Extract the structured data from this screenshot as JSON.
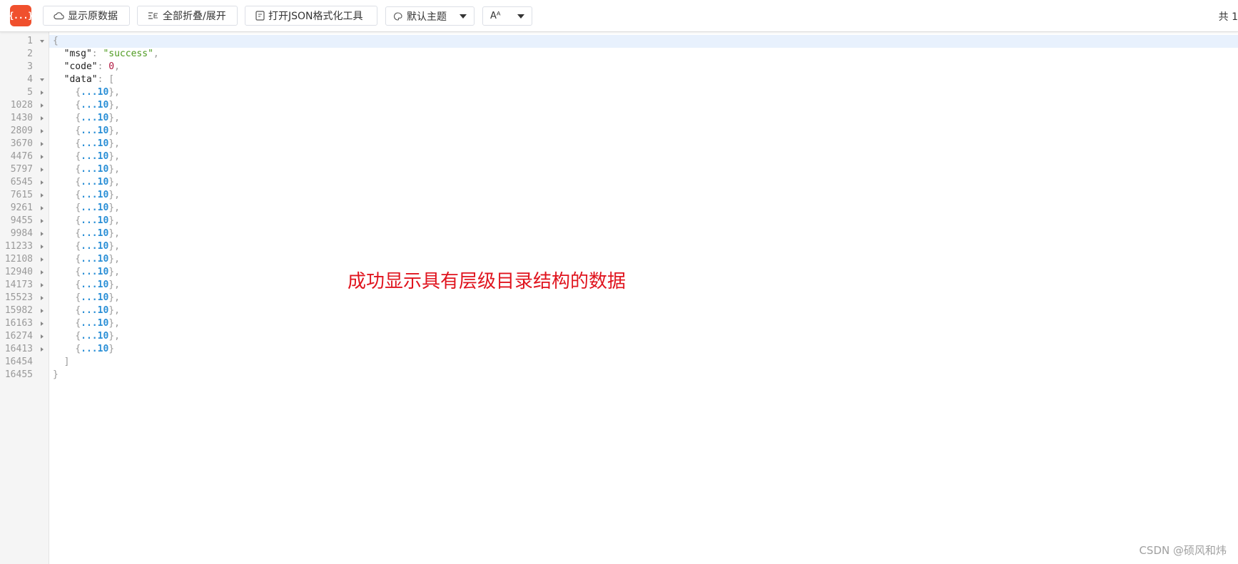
{
  "toolbar": {
    "logo_text": "{...}",
    "raw_button": "显示原数据",
    "collapse_button": "全部折叠/展开",
    "format_tool_button": "打开JSON格式化工具",
    "theme_select": "默认主题",
    "font_select": "Aᴬ",
    "total_label": "共 1"
  },
  "editor": {
    "root_open": "{",
    "root_close": "}",
    "msg_key": "\"msg\"",
    "msg_value": "\"success\"",
    "code_key": "\"code\"",
    "code_value": "0",
    "data_key": "\"data\"",
    "data_open": "[",
    "data_close": "]",
    "line_numbers": {
      "root": "1",
      "msg": "2",
      "code": "3",
      "data": "4",
      "data_close": "16454",
      "root_close": "16455"
    },
    "items": [
      {
        "line": "5",
        "summary": "...10",
        "comma": ","
      },
      {
        "line": "1028",
        "summary": "...10",
        "comma": ","
      },
      {
        "line": "1430",
        "summary": "...10",
        "comma": ","
      },
      {
        "line": "2809",
        "summary": "...10",
        "comma": ","
      },
      {
        "line": "3670",
        "summary": "...10",
        "comma": ","
      },
      {
        "line": "4476",
        "summary": "...10",
        "comma": ","
      },
      {
        "line": "5797",
        "summary": "...10",
        "comma": ","
      },
      {
        "line": "6545",
        "summary": "...10",
        "comma": ","
      },
      {
        "line": "7615",
        "summary": "...10",
        "comma": ","
      },
      {
        "line": "9261",
        "summary": "...10",
        "comma": ","
      },
      {
        "line": "9455",
        "summary": "...10",
        "comma": ","
      },
      {
        "line": "9984",
        "summary": "...10",
        "comma": ","
      },
      {
        "line": "11233",
        "summary": "...10",
        "comma": ","
      },
      {
        "line": "12108",
        "summary": "...10",
        "comma": ","
      },
      {
        "line": "12940",
        "summary": "...10",
        "comma": ","
      },
      {
        "line": "14173",
        "summary": "...10",
        "comma": ","
      },
      {
        "line": "15523",
        "summary": "...10",
        "comma": ","
      },
      {
        "line": "15982",
        "summary": "...10",
        "comma": ","
      },
      {
        "line": "16163",
        "summary": "...10",
        "comma": ","
      },
      {
        "line": "16274",
        "summary": "...10",
        "comma": ","
      },
      {
        "line": "16413",
        "summary": "...10",
        "comma": ""
      }
    ]
  },
  "annotation": "成功显示具有层级目录结构的数据",
  "watermark": "CSDN @硕风和炜"
}
